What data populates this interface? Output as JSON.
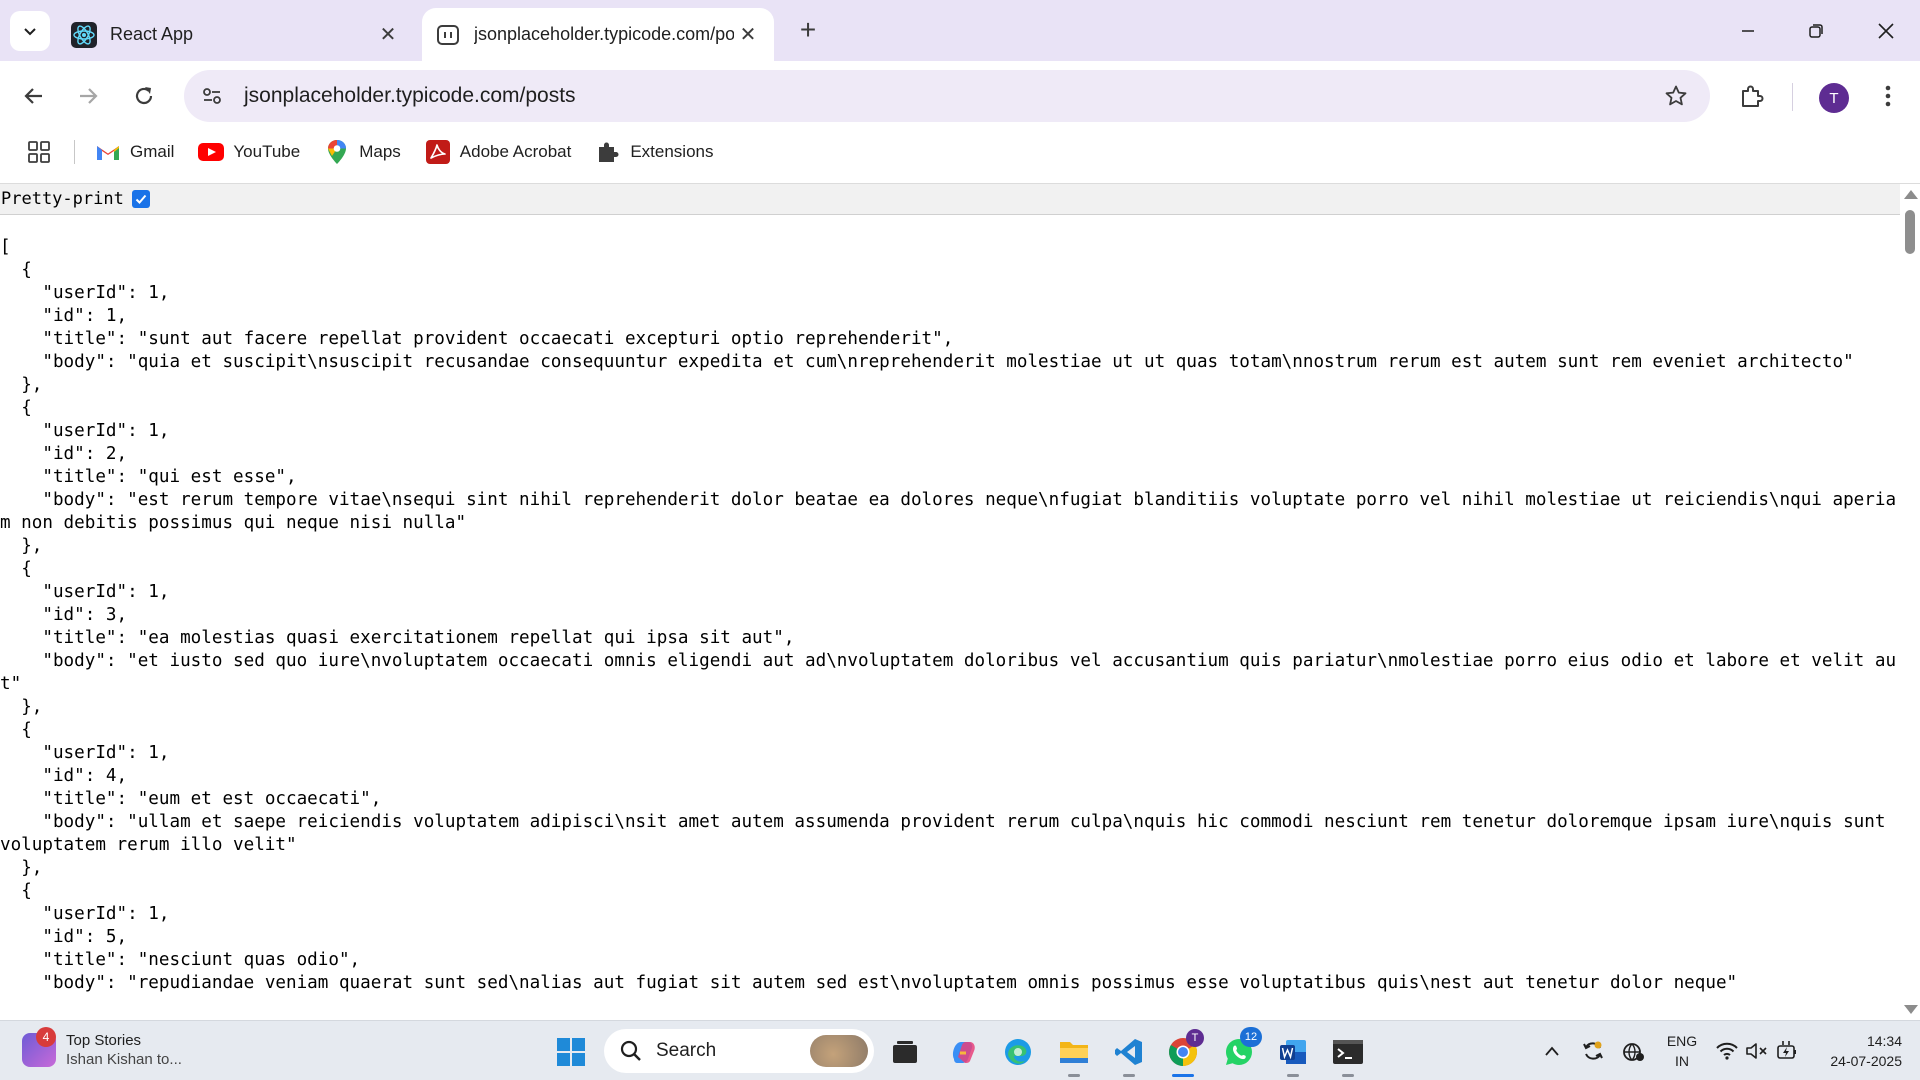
{
  "browser": {
    "tabs": [
      {
        "title": "React App",
        "favicon": "react-icon",
        "active": false
      },
      {
        "title": "jsonplaceholder.typicode.com/pos",
        "favicon": "page-icon",
        "active": true
      }
    ],
    "address_bar": {
      "url": "jsonplaceholder.typicode.com/posts"
    },
    "profile_initial": "T",
    "bookmarks": [
      {
        "label": "Gmail",
        "icon": "gmail-icon"
      },
      {
        "label": "YouTube",
        "icon": "youtube-icon"
      },
      {
        "label": "Maps",
        "icon": "maps-icon"
      },
      {
        "label": "Adobe Acrobat",
        "icon": "acrobat-icon"
      },
      {
        "label": "Extensions",
        "icon": "puzzle-icon"
      }
    ]
  },
  "page": {
    "pretty_print_label": "Pretty-print",
    "pretty_print_checked": true,
    "json_text": "[\n  {\n    \"userId\": 1,\n    \"id\": 1,\n    \"title\": \"sunt aut facere repellat provident occaecati excepturi optio reprehenderit\",\n    \"body\": \"quia et suscipit\\nsuscipit recusandae consequuntur expedita et cum\\nreprehenderit molestiae ut ut quas totam\\nnostrum rerum est autem sunt rem eveniet architecto\"\n  },\n  {\n    \"userId\": 1,\n    \"id\": 2,\n    \"title\": \"qui est esse\",\n    \"body\": \"est rerum tempore vitae\\nsequi sint nihil reprehenderit dolor beatae ea dolores neque\\nfugiat blanditiis voluptate porro vel nihil molestiae ut reiciendis\\nqui aperiam non debitis possimus qui neque nisi nulla\"\n  },\n  {\n    \"userId\": 1,\n    \"id\": 3,\n    \"title\": \"ea molestias quasi exercitationem repellat qui ipsa sit aut\",\n    \"body\": \"et iusto sed quo iure\\nvoluptatem occaecati omnis eligendi aut ad\\nvoluptatem doloribus vel accusantium quis pariatur\\nmolestiae porro eius odio et labore et velit aut\"\n  },\n  {\n    \"userId\": 1,\n    \"id\": 4,\n    \"title\": \"eum et est occaecati\",\n    \"body\": \"ullam et saepe reiciendis voluptatem adipisci\\nsit amet autem assumenda provident rerum culpa\\nquis hic commodi nesciunt rem tenetur doloremque ipsam iure\\nquis sunt voluptatem rerum illo velit\"\n  },\n  {\n    \"userId\": 1,\n    \"id\": 5,\n    \"title\": \"nesciunt quas odio\",\n    \"body\": \"repudiandae veniam quaerat sunt sed\\nalias aut fugiat sit autem sed est\\nvoluptatem omnis possimus esse voluptatibus quis\\nest aut tenetur dolor neque\""
  },
  "taskbar": {
    "news": {
      "title": "Top Stories",
      "subtitle": "Ishan Kishan to...",
      "badge": "4"
    },
    "search_placeholder": "Search",
    "whatsapp_badge": "12",
    "chrome_badge": "T",
    "language": {
      "line1": "ENG",
      "line2": "IN"
    },
    "time": "14:34",
    "date": "24-07-2025"
  }
}
